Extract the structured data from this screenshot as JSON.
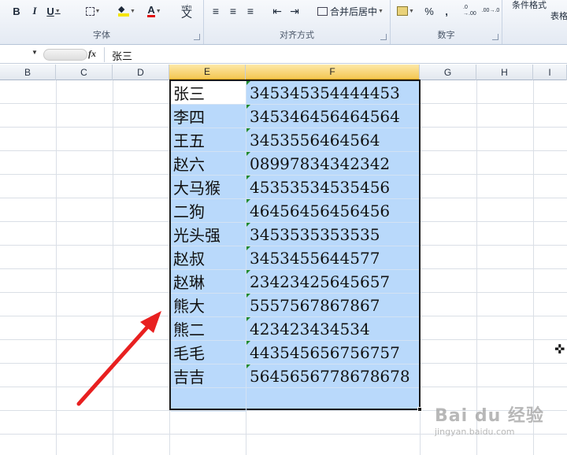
{
  "ribbon": {
    "font_group": {
      "bold": "B",
      "italic": "I",
      "underline": "U",
      "wen": "wén",
      "label": "字体"
    },
    "alignment_group": {
      "merge_label": "合并后居中",
      "label": "对齐方式"
    },
    "number_group": {
      "percent": "%",
      "comma": ",",
      "inc_decimal": ".0 →.00",
      "dec_decimal": ".00→.0",
      "label": "数字"
    },
    "styles_group": {
      "conditional_format": "条件格式",
      "table_format": "表格"
    }
  },
  "formula_bar": {
    "fx": "fx",
    "value": "张三"
  },
  "columns": [
    "B",
    "C",
    "D",
    "E",
    "F",
    "G",
    "H",
    "I"
  ],
  "selected_columns": [
    "E",
    "F"
  ],
  "rows": [
    {
      "name": "张三",
      "number": "345345354444453"
    },
    {
      "name": "李四",
      "number": "345346456464564"
    },
    {
      "name": "王五",
      "number": "3453556464564"
    },
    {
      "name": "赵六",
      "number": "08997834342342"
    },
    {
      "name": "大马猴",
      "number": "45353534535456"
    },
    {
      "name": "二狗",
      "number": "46456456456456"
    },
    {
      "name": "光头强",
      "number": "3453535353535"
    },
    {
      "name": "赵叔",
      "number": "3453455644577"
    },
    {
      "name": "赵琳",
      "number": "23423425645657"
    },
    {
      "name": "熊大",
      "number": "5557567867867"
    },
    {
      "name": "熊二",
      "number": "423423434534"
    },
    {
      "name": "毛毛",
      "number": "443545656756757"
    },
    {
      "name": "吉吉",
      "number": "5645656778678678"
    }
  ],
  "colors": {
    "selection": "#b9d9fb",
    "header_selected": "#f4c753",
    "arrow": "#e82020",
    "number_text_flag": "#1f8a2e"
  },
  "annotation": {
    "icon": "red-arrow-pointer"
  },
  "watermark": {
    "brand": "Bai du 经验",
    "url": "jingyan.baidu.com"
  }
}
